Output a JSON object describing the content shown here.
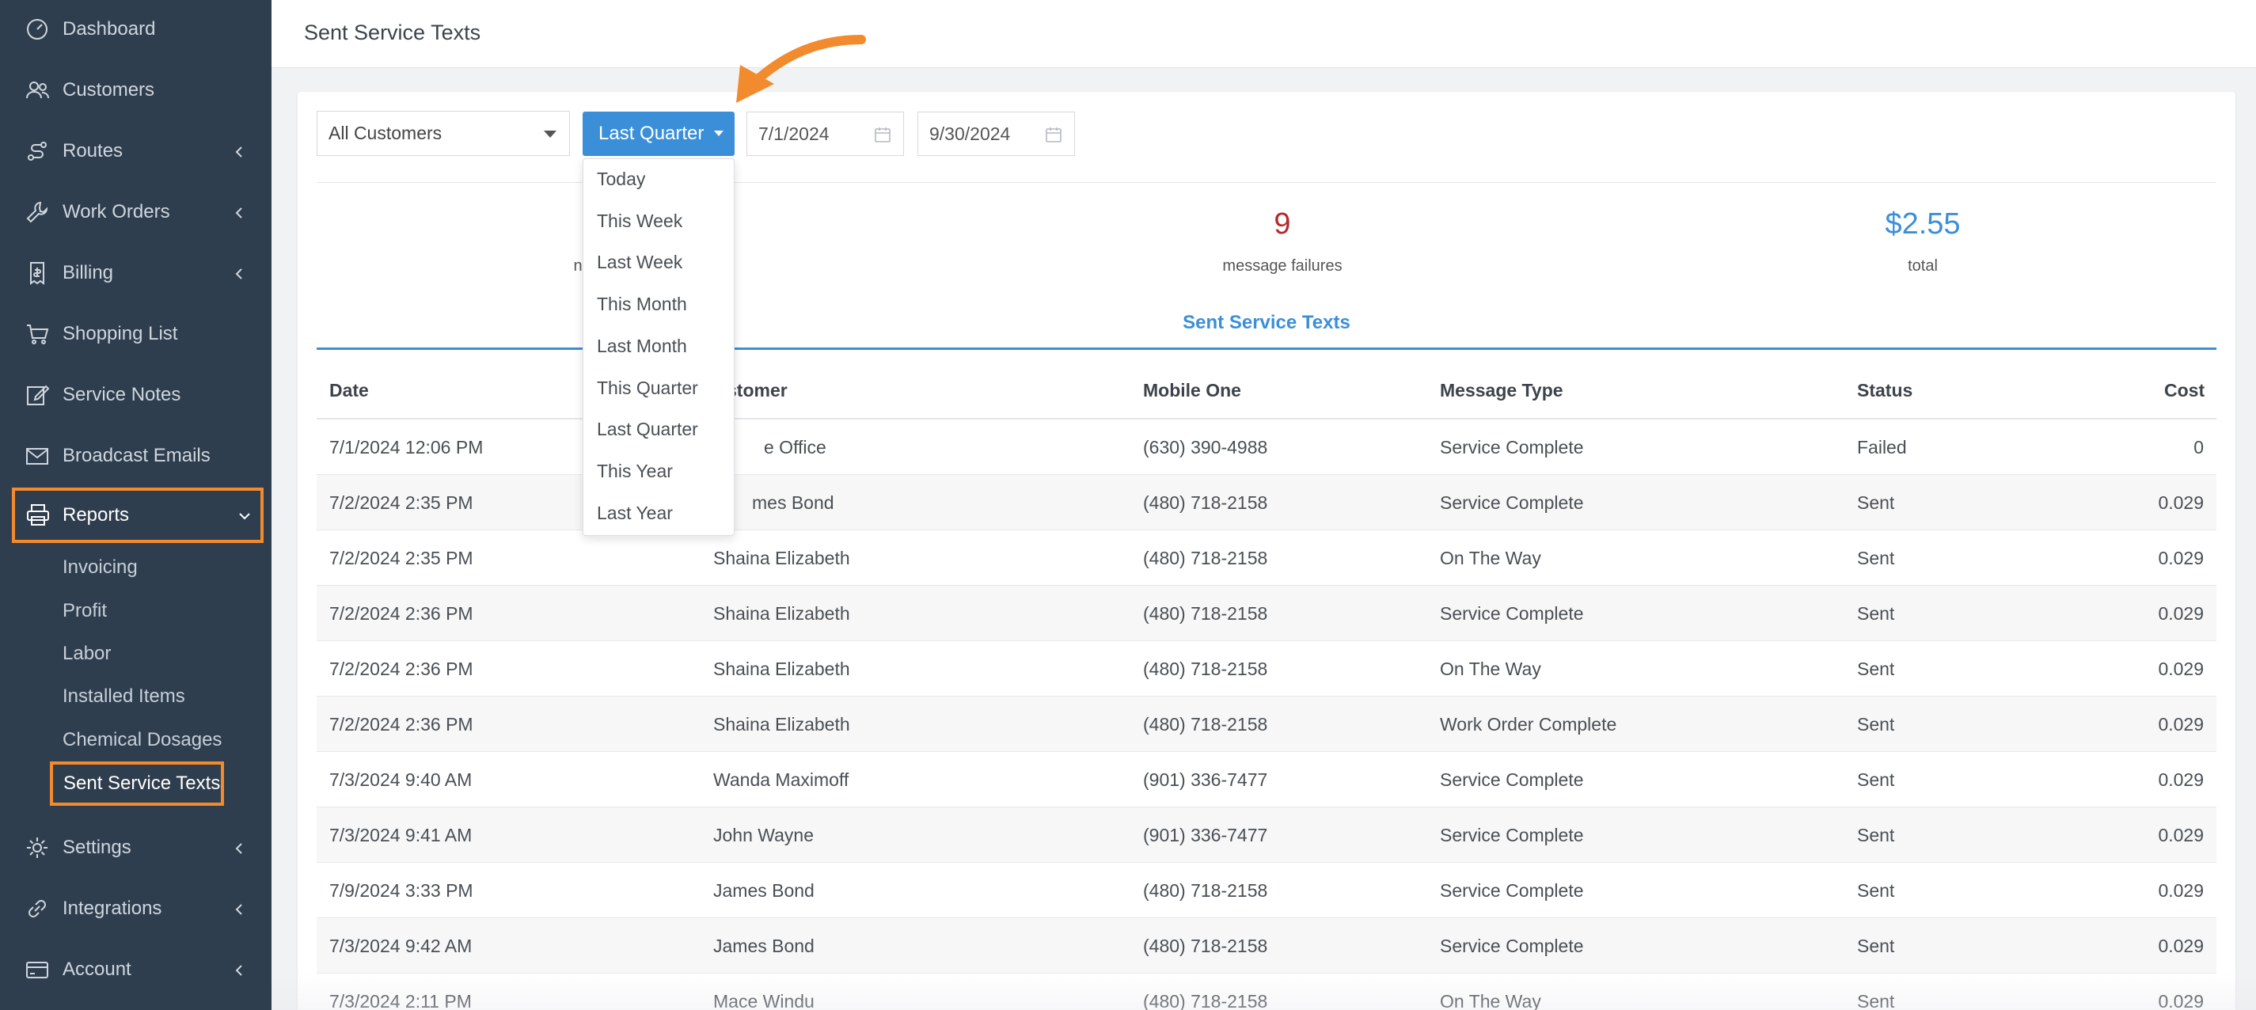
{
  "sidebar": {
    "items": [
      {
        "label": "Dashboard",
        "icon": "dashboard-icon"
      },
      {
        "label": "Customers",
        "icon": "users-icon"
      },
      {
        "label": "Routes",
        "icon": "route-icon"
      },
      {
        "label": "Work Orders",
        "icon": "wrench-icon"
      },
      {
        "label": "Billing",
        "icon": "invoice-icon"
      },
      {
        "label": "Shopping List",
        "icon": "cart-icon"
      },
      {
        "label": "Service Notes",
        "icon": "pencil-icon"
      },
      {
        "label": "Broadcast Emails",
        "icon": "envelope-icon"
      },
      {
        "label": "Reports",
        "icon": "printer-icon"
      },
      {
        "label": "Settings",
        "icon": "gear-icon"
      },
      {
        "label": "Integrations",
        "icon": "link-icon"
      },
      {
        "label": "Account",
        "icon": "card-icon"
      }
    ],
    "reports_sub": [
      "Invoicing",
      "Profit",
      "Labor",
      "Installed Items",
      "Chemical Dosages",
      "Sent Service Texts"
    ]
  },
  "header": {
    "title": "Sent Service Texts"
  },
  "filters": {
    "customer_select": "All Customers",
    "range_button": "Last Quarter",
    "start_date": "7/1/2024",
    "end_date": "9/30/2024"
  },
  "dropdown": {
    "options": [
      "Today",
      "This Week",
      "Last Week",
      "This Month",
      "Last Month",
      "This Quarter",
      "Last Quarter",
      "This Year",
      "Last Year"
    ]
  },
  "stats": {
    "left_label_fragment": "n",
    "failures_value": "9",
    "failures_label": "message failures",
    "total_value": "$2.55",
    "total_label": "total",
    "failures_color": "#b5282c",
    "total_color": "#3b8fd8"
  },
  "table": {
    "section_title": "Sent Service Texts",
    "columns": [
      "Date",
      "Customer",
      "Mobile One",
      "Message Type",
      "Status",
      "Cost"
    ],
    "header_customer_visible": "stomer",
    "rows": [
      {
        "date": "7/1/2024 12:06 PM",
        "customer": "e Office",
        "mobile": "(630) 390-4988",
        "type": "Service Complete",
        "status": "Failed",
        "cost": "0"
      },
      {
        "date": "7/2/2024 2:35 PM",
        "customer": "mes Bond",
        "mobile": "(480) 718-2158",
        "type": "Service Complete",
        "status": "Sent",
        "cost": "0.029"
      },
      {
        "date": "7/2/2024 2:35 PM",
        "customer": "Shaina Elizabeth",
        "mobile": "(480) 718-2158",
        "type": "On The Way",
        "status": "Sent",
        "cost": "0.029"
      },
      {
        "date": "7/2/2024 2:36 PM",
        "customer": "Shaina Elizabeth",
        "mobile": "(480) 718-2158",
        "type": "Service Complete",
        "status": "Sent",
        "cost": "0.029"
      },
      {
        "date": "7/2/2024 2:36 PM",
        "customer": "Shaina Elizabeth",
        "mobile": "(480) 718-2158",
        "type": "On The Way",
        "status": "Sent",
        "cost": "0.029"
      },
      {
        "date": "7/2/2024 2:36 PM",
        "customer": "Shaina Elizabeth",
        "mobile": "(480) 718-2158",
        "type": "Work Order Complete",
        "status": "Sent",
        "cost": "0.029"
      },
      {
        "date": "7/3/2024 9:40 AM",
        "customer": "Wanda Maximoff",
        "mobile": "(901) 336-7477",
        "type": "Service Complete",
        "status": "Sent",
        "cost": "0.029"
      },
      {
        "date": "7/3/2024 9:41 AM",
        "customer": "John Wayne",
        "mobile": "(901) 336-7477",
        "type": "Service Complete",
        "status": "Sent",
        "cost": "0.029"
      },
      {
        "date": "7/9/2024 3:33 PM",
        "customer": "James Bond",
        "mobile": "(480) 718-2158",
        "type": "Service Complete",
        "status": "Sent",
        "cost": "0.029"
      },
      {
        "date": "7/3/2024 9:42 AM",
        "customer": "James Bond",
        "mobile": "(480) 718-2158",
        "type": "Service Complete",
        "status": "Sent",
        "cost": "0.029"
      },
      {
        "date": "7/3/2024 2:11 PM",
        "customer": "Mace Windu",
        "mobile": "(480) 718-2158",
        "type": "On The Way",
        "status": "Sent",
        "cost": "0.029"
      }
    ]
  },
  "colors": {
    "accent": "#3b8fd8",
    "highlight": "#f28a2e",
    "sidebar": "#2f3e4e"
  }
}
